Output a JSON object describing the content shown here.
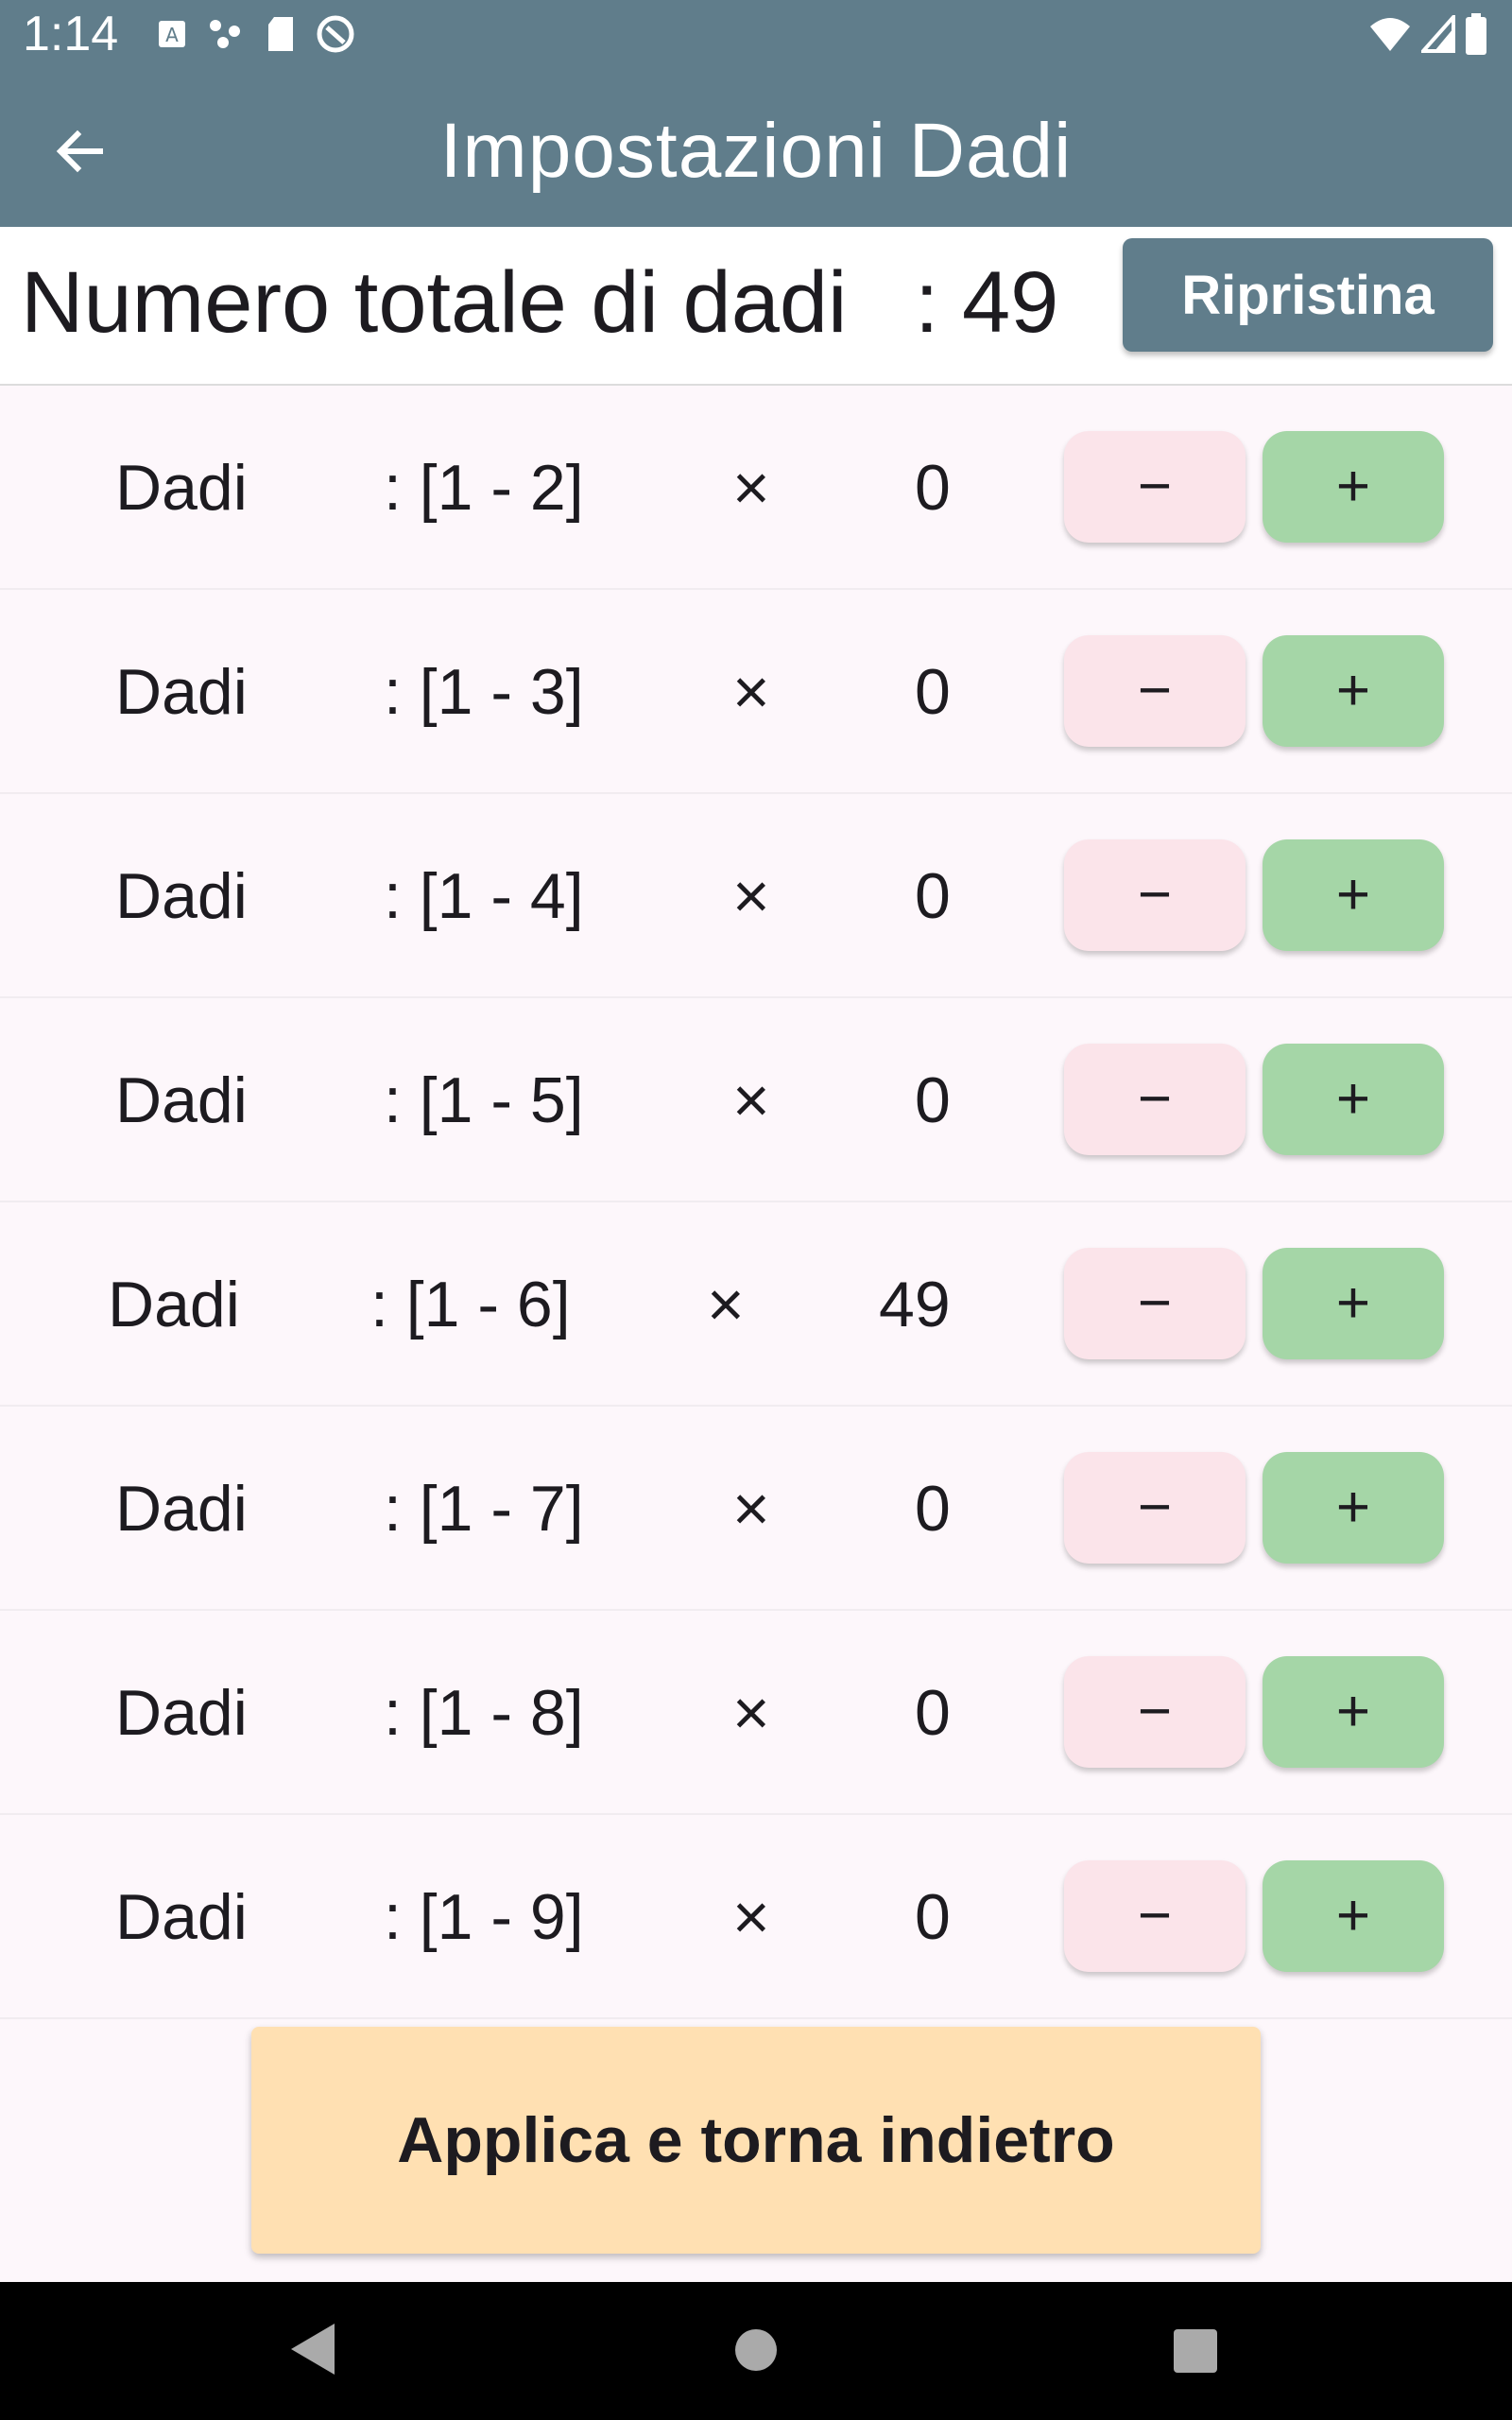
{
  "status_bar": {
    "time": "1:14",
    "left_icons": [
      "a-notification-icon",
      "dots-notification-icon",
      "sd-card-icon",
      "sync-icon"
    ],
    "right_icons": [
      "wifi-icon",
      "signal-icon",
      "battery-icon"
    ]
  },
  "app_bar": {
    "title": "Impostazioni Dadi",
    "back_icon": "arrow-back-icon",
    "color": "#607d8b"
  },
  "summary": {
    "label": "Numero totale di dadi",
    "colon": ":",
    "value": "49",
    "reset_label": "Ripristina"
  },
  "dice_rows": [
    {
      "label": "Dadi",
      "range": ": [1 - 2]",
      "times": "×",
      "count": "0",
      "minus": "−",
      "plus": "+"
    },
    {
      "label": "Dadi",
      "range": ": [1 - 3]",
      "times": "×",
      "count": "0",
      "minus": "−",
      "plus": "+"
    },
    {
      "label": "Dadi",
      "range": ": [1 - 4]",
      "times": "×",
      "count": "0",
      "minus": "−",
      "plus": "+"
    },
    {
      "label": "Dadi",
      "range": ": [1 - 5]",
      "times": "×",
      "count": "0",
      "minus": "−",
      "plus": "+"
    },
    {
      "label": "Dadi",
      "range": ": [1 - 6]",
      "times": "×",
      "count": "49",
      "minus": "−",
      "plus": "+"
    },
    {
      "label": "Dadi",
      "range": ": [1 - 7]",
      "times": "×",
      "count": "0",
      "minus": "−",
      "plus": "+"
    },
    {
      "label": "Dadi",
      "range": ": [1 - 8]",
      "times": "×",
      "count": "0",
      "minus": "−",
      "plus": "+"
    },
    {
      "label": "Dadi",
      "range": ": [1 - 9]",
      "times": "×",
      "count": "0",
      "minus": "−",
      "plus": "+"
    }
  ],
  "apply_button": {
    "label": "Applica e torna indietro",
    "color": "#ffe0b2"
  },
  "colors": {
    "minus_button": "#fbe4ea",
    "plus_button": "#a5d6a7",
    "background": "#fdf7fb"
  }
}
